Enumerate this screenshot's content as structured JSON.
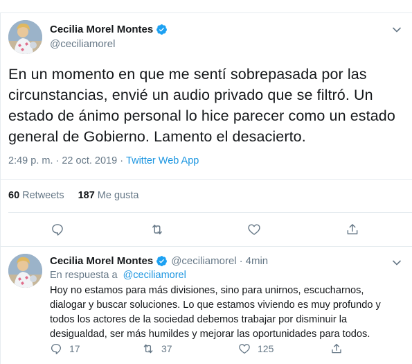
{
  "main_tweet": {
    "display_name": "Cecilia Morel Montes",
    "handle": "@ceciliamorel",
    "text": "En un momento en que me sentí sobrepasada por las circunstancias, envié un audio privado que se filtró. Un estado de ánimo personal lo hice parecer como un estado general de Gobierno. Lamento el desacierto.",
    "timestamp": "2:49 p. m. · 22 oct. 2019 ·",
    "source": "Twitter Web App",
    "retweets_count": "60",
    "retweets_label": "Retweets",
    "likes_count": "187",
    "likes_label": "Me gusta"
  },
  "reply_tweet": {
    "display_name": "Cecilia Morel Montes",
    "handle": "@ceciliamorel",
    "separator": "·",
    "time": "4min",
    "in_reply_label": "En respuesta a",
    "in_reply_mention": "@ceciliamorel",
    "text": "Hoy no estamos para más divisiones, sino para unirnos, escucharnos, dialogar y buscar soluciones. Lo que estamos viviendo es muy profundo y todos los actores de la sociedad debemos trabajar por disminuir la desigualdad, ser más humildes y mejorar las oportunidades para todos.",
    "replies_count": "17",
    "retweets_count": "37",
    "likes_count": "125"
  },
  "colors": {
    "link_blue": "#1b95e0",
    "muted_gray": "#657786",
    "text_dark": "#14171a",
    "divider": "#e6ecf0",
    "verified_blue": "#1da1f2"
  },
  "icons": {
    "verified": "verified-badge-icon",
    "more": "chevron-down-icon",
    "reply": "reply-icon",
    "retweet": "retweet-icon",
    "like": "heart-icon",
    "share": "share-icon"
  }
}
